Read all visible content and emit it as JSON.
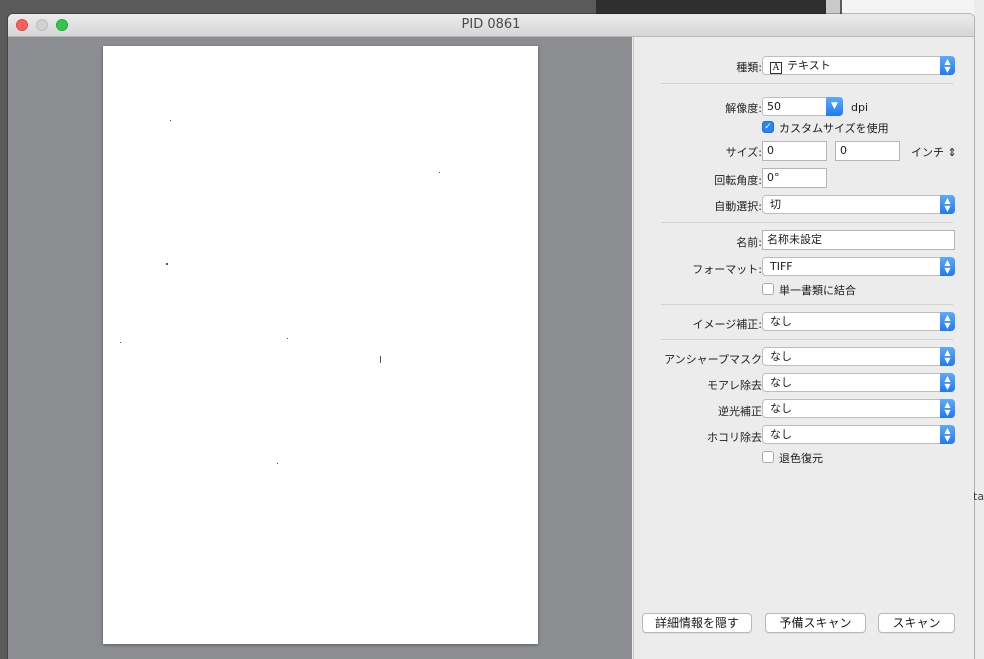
{
  "window": {
    "title": "PID 0861"
  },
  "panel": {
    "kind": {
      "label": "種類:",
      "value": "テキスト"
    },
    "resolution": {
      "label": "解像度:",
      "value": "50",
      "unit": "dpi"
    },
    "custom_size": {
      "label": "カスタムサイズを使用",
      "checked": true
    },
    "size": {
      "label": "サイズ:",
      "width": "0",
      "height": "0",
      "unit": "インチ"
    },
    "rotation": {
      "label": "回転角度:",
      "value": "0°"
    },
    "auto_select": {
      "label": "自動選択:",
      "value": "切"
    },
    "name": {
      "label": "名前:",
      "value": "名称未設定"
    },
    "format": {
      "label": "フォーマット:",
      "value": "TIFF"
    },
    "single_doc": {
      "label": "単一書類に結合",
      "checked": false
    },
    "image_correction": {
      "label": "イメージ補正:",
      "value": "なし"
    },
    "unsharp_mask": {
      "label": "アンシャープマスク",
      "value": "なし"
    },
    "moire": {
      "label": "モアレ除去",
      "value": "なし"
    },
    "backlight": {
      "label": "逆光補正",
      "value": "なし"
    },
    "dust": {
      "label": "ホコリ除去",
      "value": "なし"
    },
    "restore_color": {
      "label": "退色復元",
      "checked": false
    }
  },
  "buttons": {
    "hide_details": "詳細情報を隠す",
    "overview": "予備スキャン",
    "scan": "スキャン"
  },
  "background": {
    "edge_text": "ta"
  }
}
